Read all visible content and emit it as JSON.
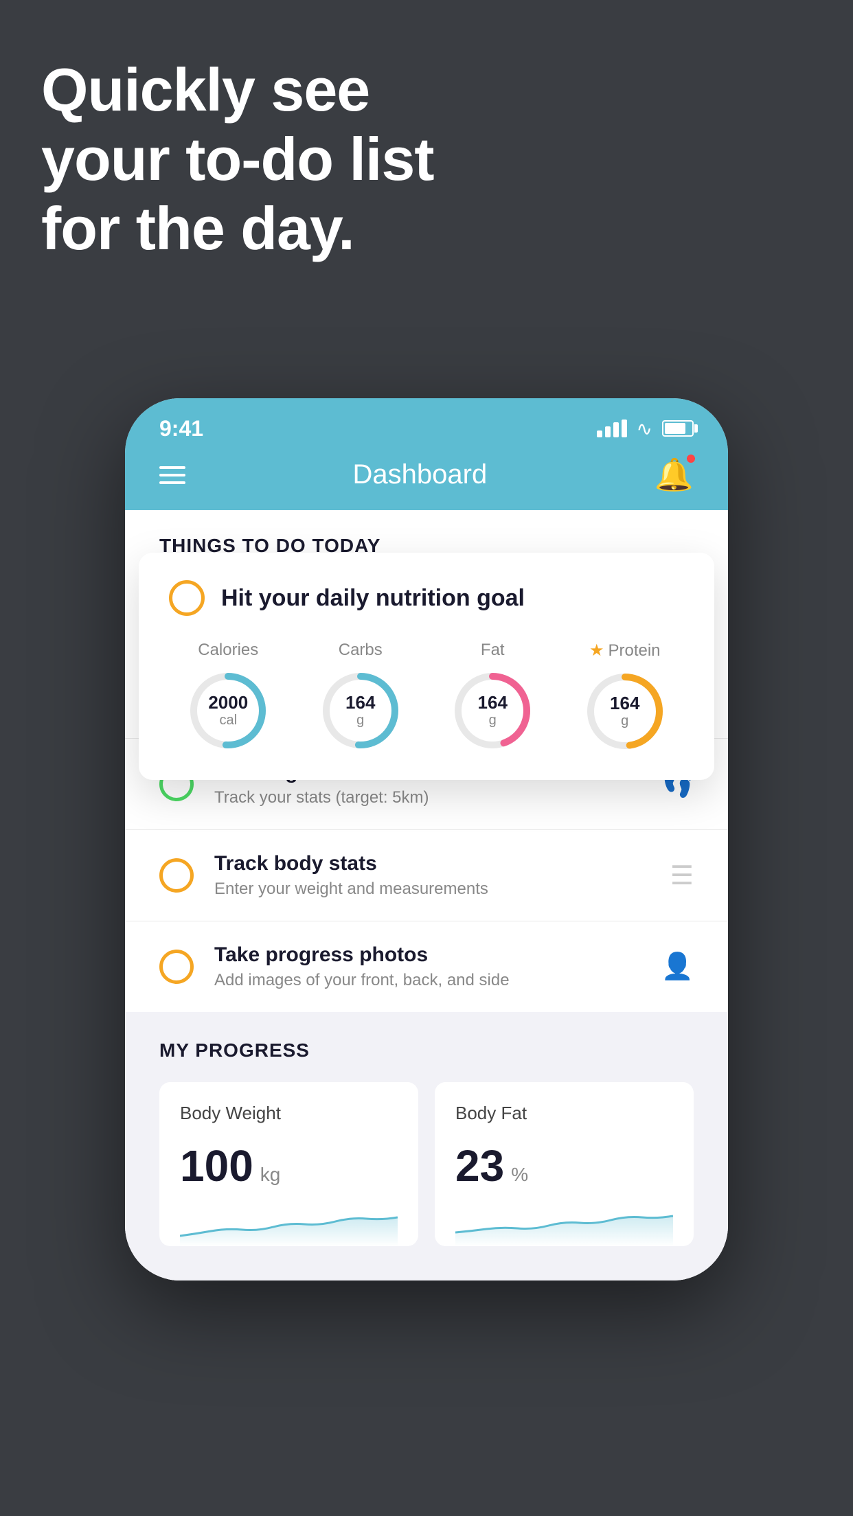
{
  "hero": {
    "line1": "Quickly see",
    "line2": "your to-do list",
    "line3": "for the day."
  },
  "status_bar": {
    "time": "9:41"
  },
  "header": {
    "title": "Dashboard"
  },
  "things_today": {
    "section_title": "THINGS TO DO TODAY"
  },
  "nutrition_card": {
    "title": "Hit your daily nutrition goal",
    "calories_label": "Calories",
    "calories_value": "2000",
    "calories_unit": "cal",
    "carbs_label": "Carbs",
    "carbs_value": "164",
    "carbs_unit": "g",
    "fat_label": "Fat",
    "fat_value": "164",
    "fat_unit": "g",
    "protein_label": "Protein",
    "protein_value": "164",
    "protein_unit": "g"
  },
  "todo_items": [
    {
      "title": "Running",
      "subtitle": "Track your stats (target: 5km)",
      "status": "green",
      "icon": "shoe"
    },
    {
      "title": "Track body stats",
      "subtitle": "Enter your weight and measurements",
      "status": "yellow",
      "icon": "scale"
    },
    {
      "title": "Take progress photos",
      "subtitle": "Add images of your front, back, and side",
      "status": "yellow",
      "icon": "person"
    }
  ],
  "progress": {
    "section_title": "MY PROGRESS",
    "body_weight_label": "Body Weight",
    "body_weight_value": "100",
    "body_weight_unit": "kg",
    "body_fat_label": "Body Fat",
    "body_fat_value": "23",
    "body_fat_unit": "%"
  }
}
